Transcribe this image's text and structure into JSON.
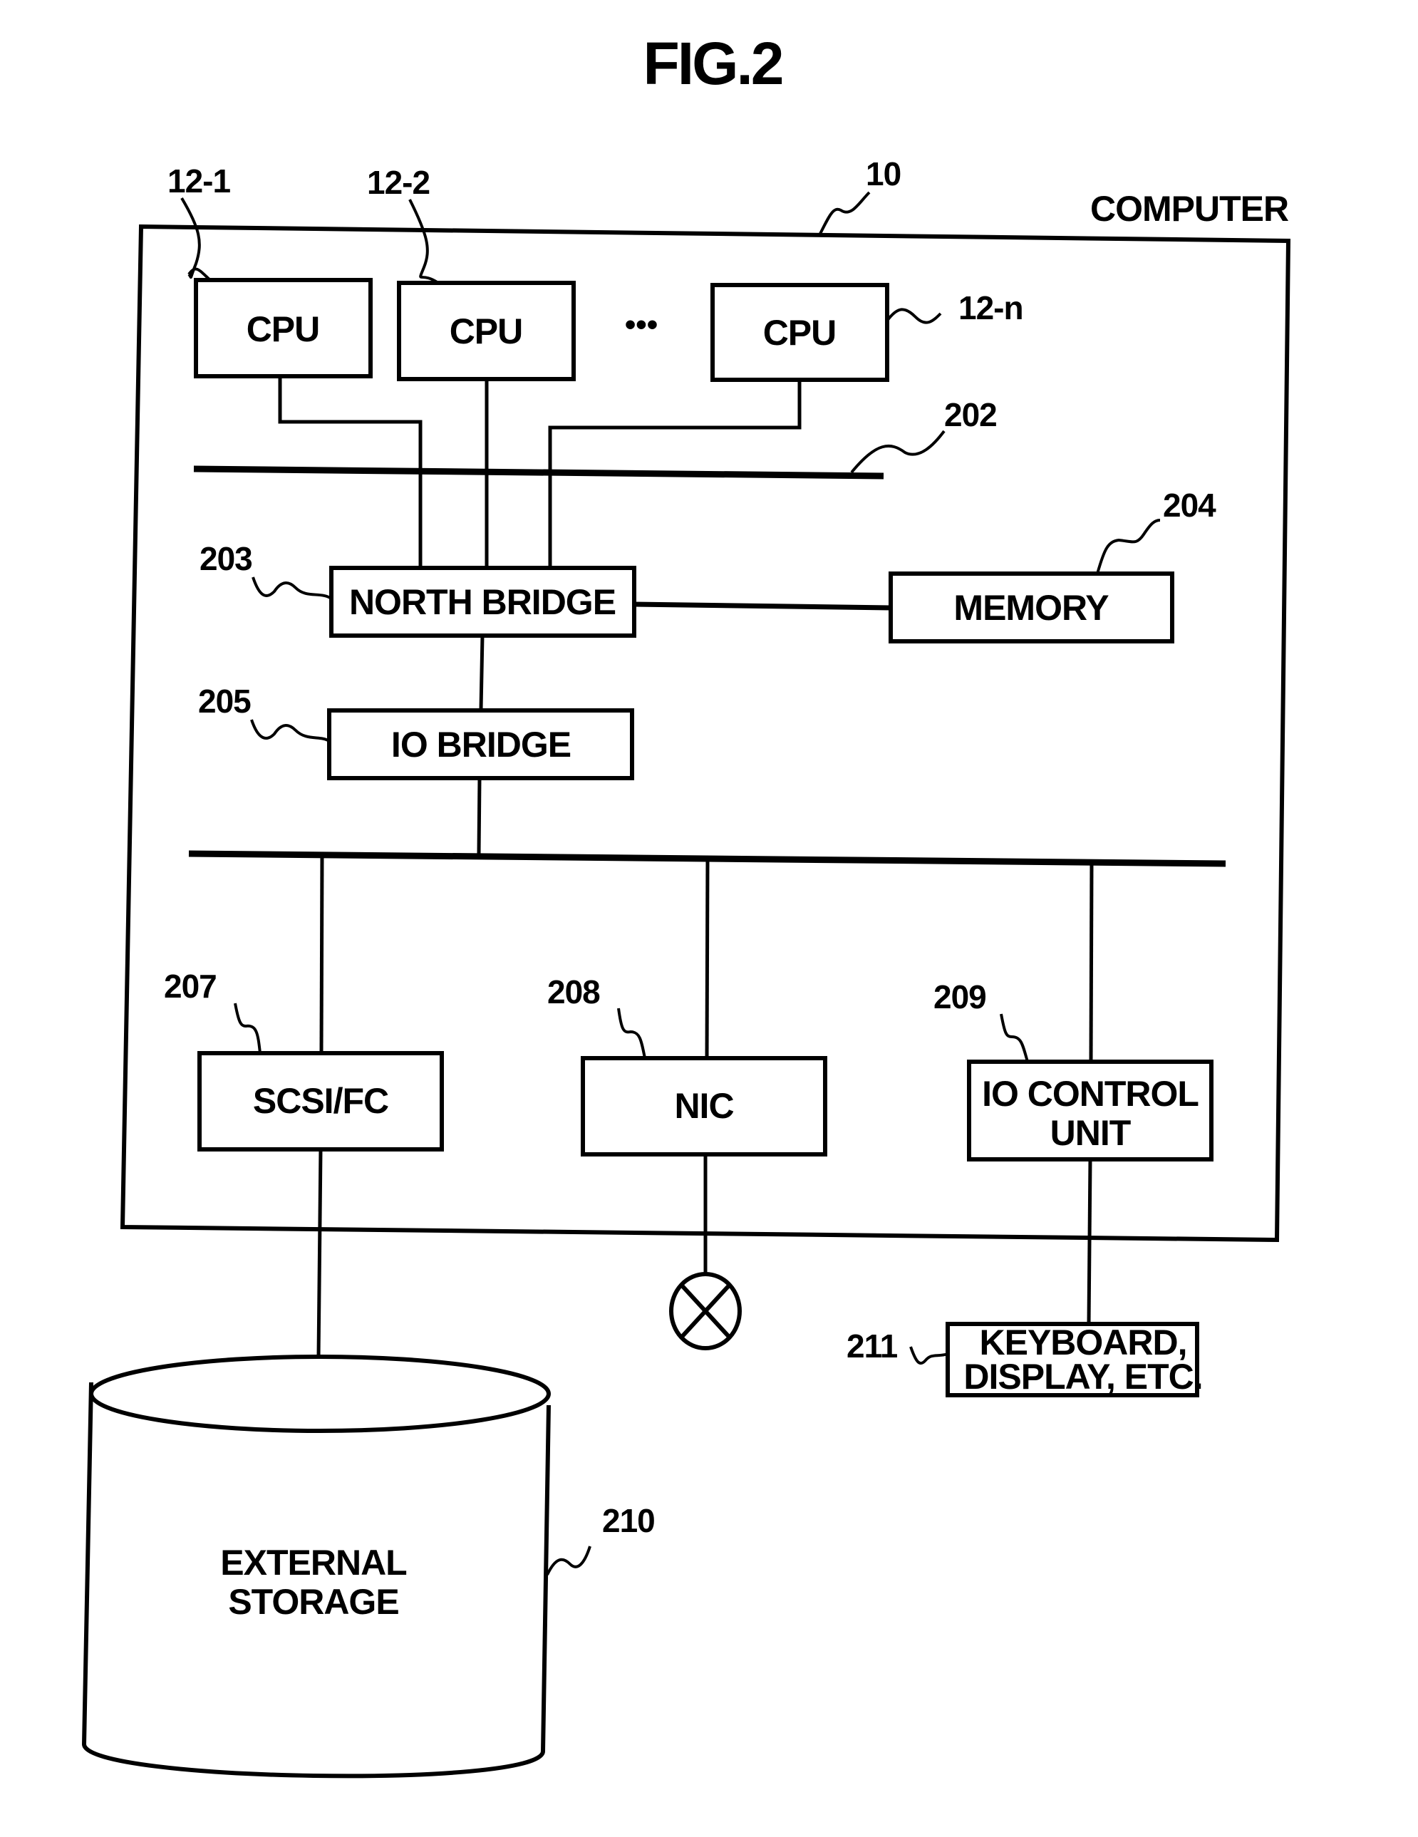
{
  "figure": {
    "title": "FIG.2",
    "computer_label": "COMPUTER",
    "computer_ref": "10"
  },
  "cpus": [
    {
      "label": "CPU",
      "ref": "12-1"
    },
    {
      "label": "CPU",
      "ref": "12-2"
    },
    {
      "label": "CPU",
      "ref": "12-n"
    }
  ],
  "ellipsis": "•••",
  "bus_ref": "202",
  "north_bridge": {
    "label": "NORTH BRIDGE",
    "ref": "203"
  },
  "memory": {
    "label": "MEMORY",
    "ref": "204"
  },
  "io_bridge": {
    "label": "IO BRIDGE",
    "ref": "205"
  },
  "scsi_fc": {
    "label": "SCSI/FC",
    "ref": "207"
  },
  "nic": {
    "label": "NIC",
    "ref": "208"
  },
  "io_control": {
    "label_line1": "IO CONTROL",
    "label_line2": "UNIT",
    "ref": "209"
  },
  "external_storage": {
    "label_line1": "EXTERNAL",
    "label_line2": "STORAGE",
    "ref": "210"
  },
  "keyboard_display": {
    "label_line1": "KEYBOARD,",
    "label_line2": "DISPLAY, ETC.",
    "ref": "211"
  },
  "network_symbol": "network-crossed-circle"
}
